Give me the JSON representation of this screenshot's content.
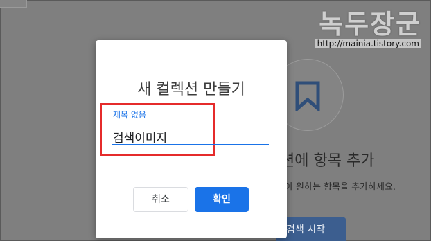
{
  "colors": {
    "accent": "#1a73e8",
    "overlay": "#7f7f7f",
    "highlight": "#e52b2b"
  },
  "watermark": {
    "title": "녹두장군",
    "url": "http://mainia.tistory.com"
  },
  "background_page": {
    "icon": "bookmark-icon",
    "heading": "션에 항목 추가",
    "description": "찾아 원하는 항목을 추가하세요.",
    "search_button": "검색 시작"
  },
  "dialog": {
    "title": "새 컬렉션 만들기",
    "field_label": "제목 없음",
    "field_value": "검색이미지",
    "cancel_label": "취소",
    "confirm_label": "확인"
  }
}
